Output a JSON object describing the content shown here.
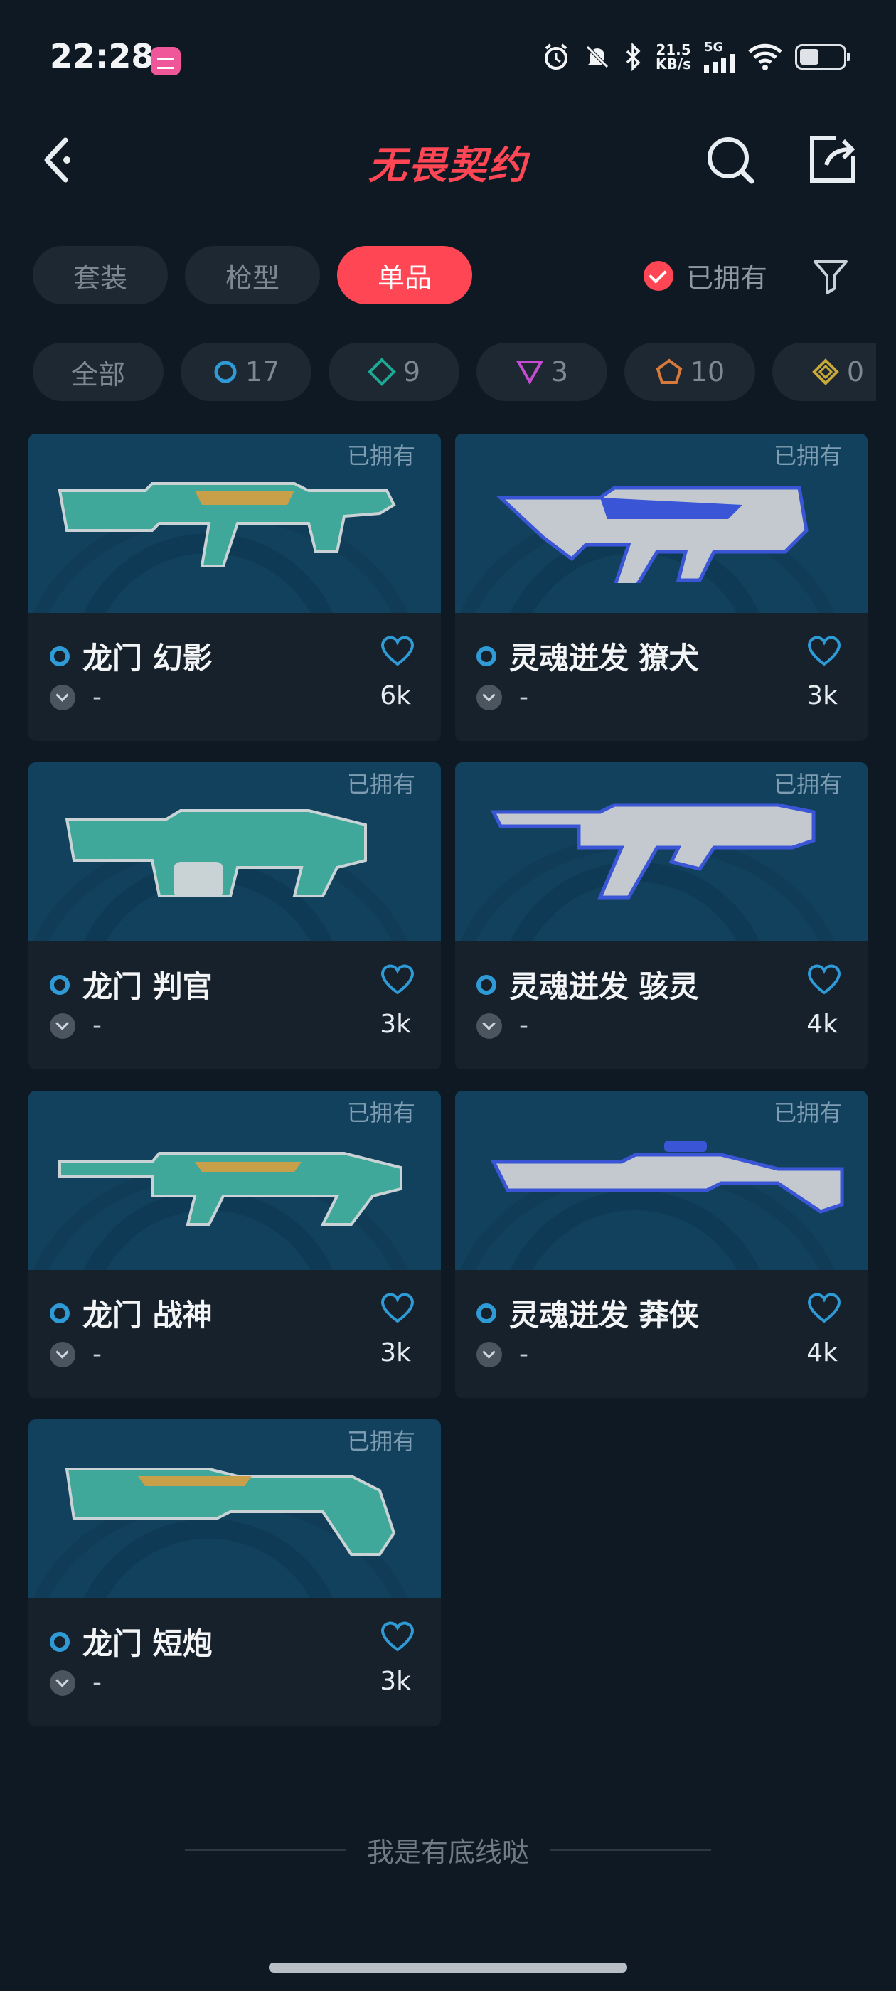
{
  "status_bar": {
    "time": "22:28",
    "net_speed_value": "21.5",
    "net_speed_unit": "KB/s",
    "network": "5G",
    "icons": [
      "alarm-icon",
      "mute-icon",
      "bluetooth-icon",
      "signal-icon",
      "wifi-icon",
      "battery-icon"
    ]
  },
  "header": {
    "logo": "无畏契约",
    "icons": [
      "back-icon",
      "search-icon",
      "share-icon"
    ]
  },
  "tabs": [
    {
      "label": "套装",
      "active": false
    },
    {
      "label": "枪型",
      "active": false
    },
    {
      "label": "单品",
      "active": true
    }
  ],
  "owned_filter": {
    "label": "已拥有",
    "checked": true
  },
  "rarity_chips": [
    {
      "label": "全部",
      "icon": ""
    },
    {
      "label": "17",
      "icon": "ring-icon",
      "color": "#2e9bd6"
    },
    {
      "label": "9",
      "icon": "diamond-icon",
      "color": "#1ea896"
    },
    {
      "label": "3",
      "icon": "triangle-icon",
      "color": "#c54bd1"
    },
    {
      "label": "10",
      "icon": "pentagon-icon",
      "color": "#d57a3a"
    },
    {
      "label": "0",
      "icon": "rhombus-icon",
      "color": "#c9a93a"
    }
  ],
  "items": [
    {
      "tag": "已拥有",
      "name": "龙门 幻影",
      "sub": "-",
      "price": "6k",
      "style": "teal"
    },
    {
      "tag": "已拥有",
      "name": "灵魂迸发 獠犬",
      "sub": "-",
      "price": "3k",
      "style": "blue"
    },
    {
      "tag": "已拥有",
      "name": "龙门 判官",
      "sub": "-",
      "price": "3k",
      "style": "teal"
    },
    {
      "tag": "已拥有",
      "name": "灵魂迸发 骇灵",
      "sub": "-",
      "price": "4k",
      "style": "blue"
    },
    {
      "tag": "已拥有",
      "name": "龙门 战神",
      "sub": "-",
      "price": "3k",
      "style": "teal"
    },
    {
      "tag": "已拥有",
      "name": "灵魂迸发 莽侠",
      "sub": "-",
      "price": "4k",
      "style": "blue"
    },
    {
      "tag": "已拥有",
      "name": "龙门 短炮",
      "sub": "-",
      "price": "3k",
      "style": "teal"
    }
  ],
  "footer": {
    "text": "我是有底线哒"
  },
  "colors": {
    "accent": "#ff4655",
    "background": "#0f1923",
    "rarity_blue": "#2e9bd6"
  }
}
